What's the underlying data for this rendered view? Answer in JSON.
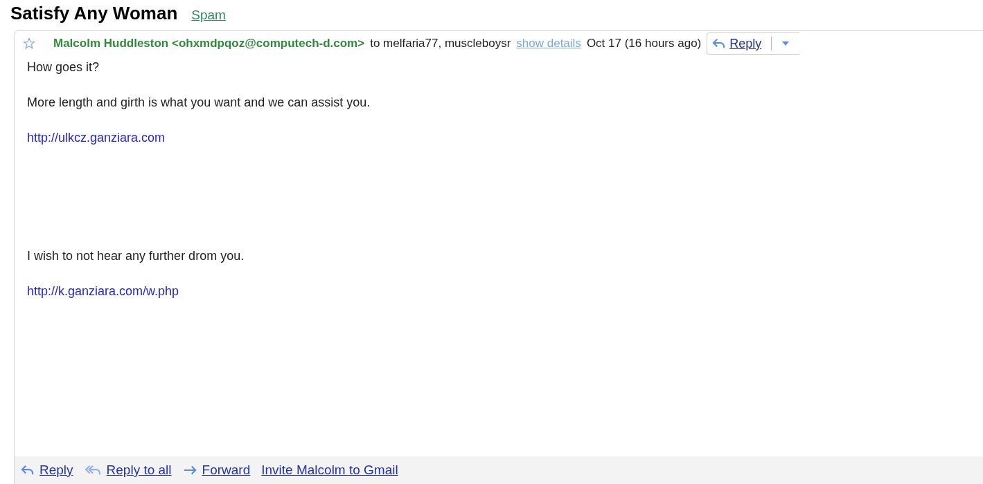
{
  "subject": "Satisfy Any Woman",
  "label": "Spam",
  "message": {
    "starred": false,
    "sender": "Malcolm Huddleston <ohxmdpqoz@computech-d.com>",
    "recipients": "to melfaria77, muscleboysr",
    "details_link": "show details",
    "date": "Oct 17 (16 hours ago)",
    "reply_button": "Reply",
    "sections": [
      {
        "paragraphs": [
          {
            "kind": "text",
            "text": "How goes it?"
          },
          {
            "kind": "text",
            "text": "More length and girth is what you want and we can assist you."
          },
          {
            "kind": "link",
            "text": "http://ulkcz.ganziara.com"
          }
        ]
      },
      {
        "paragraphs": [
          {
            "kind": "text",
            "text": "I wish to not hear any further drom you."
          },
          {
            "kind": "link",
            "text": "http://k.ganziara.com/w.php"
          }
        ]
      }
    ]
  },
  "actions": [
    {
      "kind": "reply",
      "label": "Reply"
    },
    {
      "kind": "reply_all",
      "label": "Reply to all"
    },
    {
      "kind": "forward",
      "label": "Forward"
    },
    {
      "kind": "invite",
      "label": "Invite Malcolm to Gmail"
    }
  ]
}
